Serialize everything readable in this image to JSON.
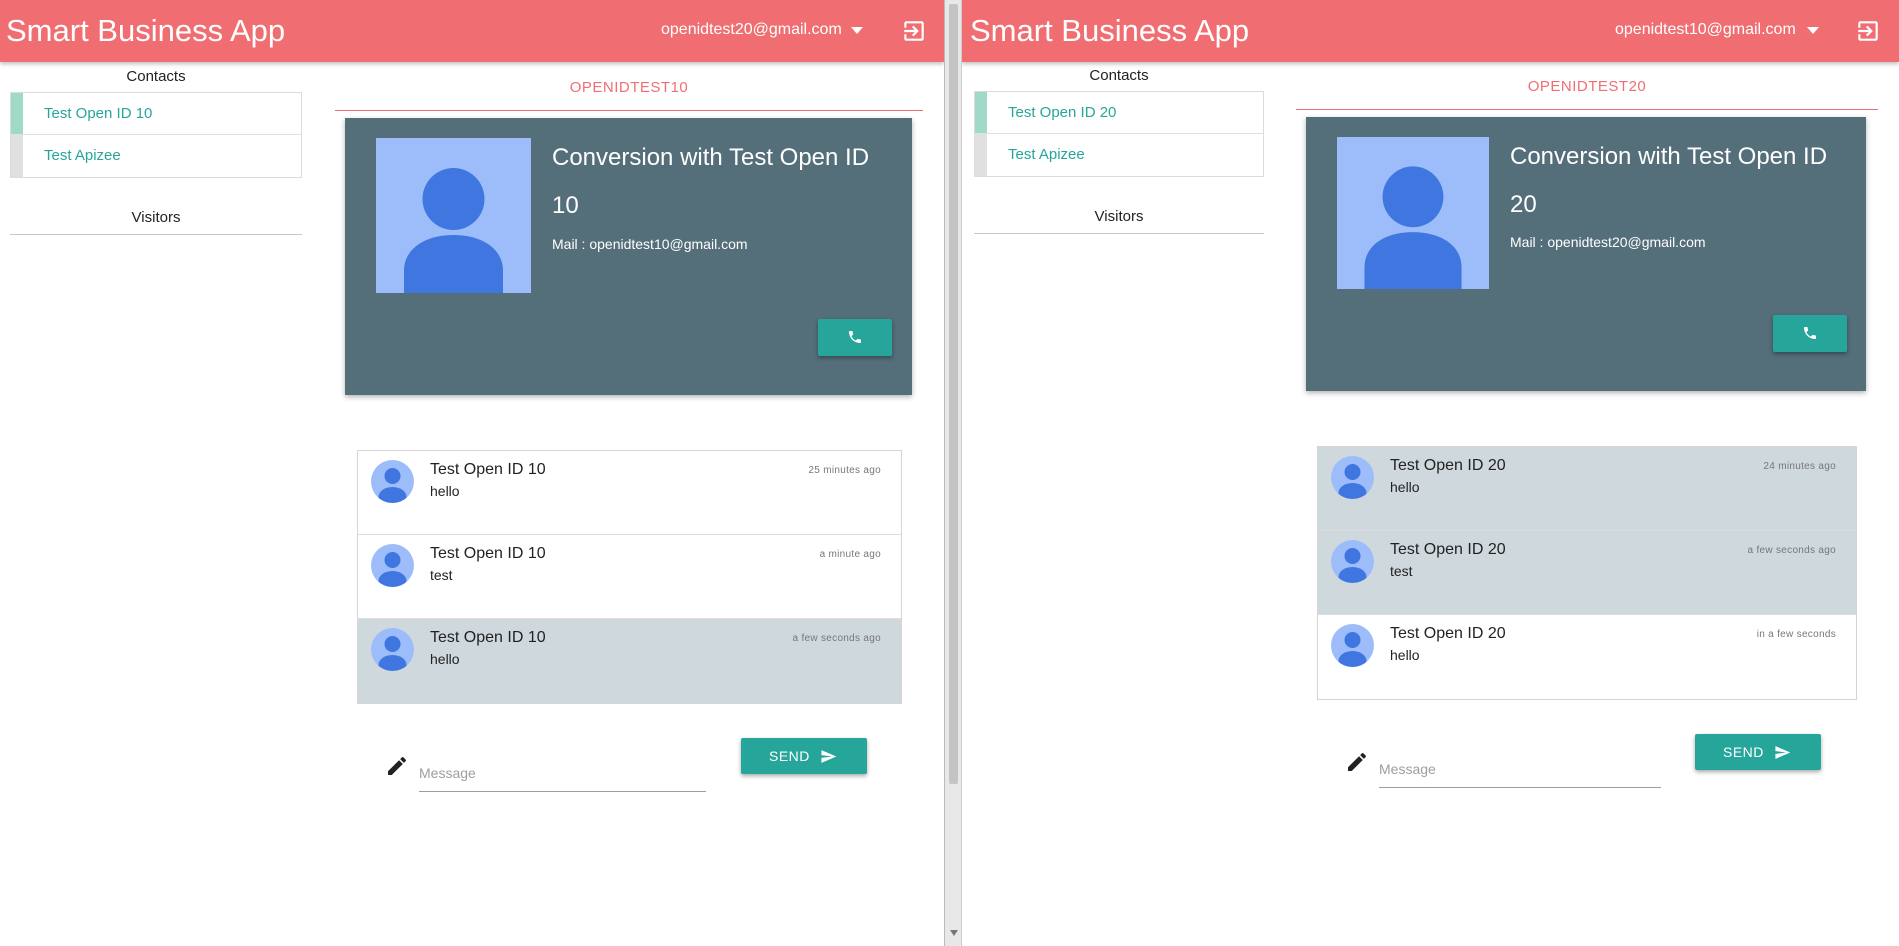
{
  "colors": {
    "topbar": "#f06e72",
    "accent": "#26a69a",
    "card": "#546e7a",
    "avatar_bg": "#9dbdfa",
    "avatar_fg": "#3f76e0",
    "selected_row": "#cfd8dc"
  },
  "left": {
    "app_title": "Smart Business App",
    "user_email": "openidtest20@gmail.com",
    "contacts_title": "Contacts",
    "contacts": [
      {
        "label": "Test Open ID 10",
        "active": true
      },
      {
        "label": "Test Apizee",
        "active": false
      }
    ],
    "visitors_title": "Visitors",
    "tab_label": "OPENIDTEST10",
    "card": {
      "headline": "Conversion with Test Open ID 10",
      "mail": "Mail : openidtest10@gmail.com",
      "call_icon": "phone-icon"
    },
    "messages": [
      {
        "name": "Test Open ID 10",
        "text": "hello",
        "time": "25 minutes ago",
        "selected": false
      },
      {
        "name": "Test Open ID 10",
        "text": "test",
        "time": "a minute ago",
        "selected": false
      },
      {
        "name": "Test Open ID 10",
        "text": "hello",
        "time": "a few seconds ago",
        "selected": true
      }
    ],
    "composer": {
      "placeholder": "Message",
      "value": "",
      "send_label": "SEND"
    }
  },
  "right": {
    "app_title": "Smart Business App",
    "user_email": "openidtest10@gmail.com",
    "contacts_title": "Contacts",
    "contacts": [
      {
        "label": "Test Open ID 20",
        "active": true
      },
      {
        "label": "Test Apizee",
        "active": false
      }
    ],
    "visitors_title": "Visitors",
    "tab_label": "OPENIDTEST20",
    "card": {
      "headline": "Conversion with Test Open ID 20",
      "mail": "Mail : openidtest20@gmail.com",
      "call_icon": "phone-icon"
    },
    "messages": [
      {
        "name": "Test Open ID 20",
        "text": "hello",
        "time": "24 minutes ago",
        "selected": true
      },
      {
        "name": "Test Open ID 20",
        "text": "test",
        "time": "a few seconds ago",
        "selected": true
      },
      {
        "name": "Test Open ID 20",
        "text": "hello",
        "time": "in a few seconds",
        "selected": false
      }
    ],
    "composer": {
      "placeholder": "Message",
      "value": "",
      "send_label": "SEND"
    }
  }
}
